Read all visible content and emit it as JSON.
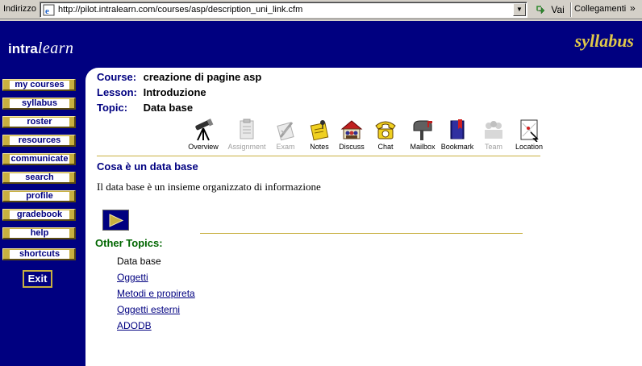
{
  "address_bar": {
    "label": "Indirizzo",
    "url": "http://pilot.intralearn.com/courses/asp/description_uni_link.cfm",
    "go_label": "Vai",
    "links_label": "Collegamenti",
    "links_chevron": "»"
  },
  "header": {
    "logo_bold": "intra",
    "logo_italic": "learn",
    "section_title": "syllabus"
  },
  "sidebar": {
    "items": [
      {
        "label": "my courses"
      },
      {
        "label": "syllabus"
      },
      {
        "label": "roster"
      },
      {
        "label": "resources"
      },
      {
        "label": "communicate"
      },
      {
        "label": "search"
      },
      {
        "label": "profile"
      },
      {
        "label": "gradebook"
      },
      {
        "label": "help"
      },
      {
        "label": "shortcuts"
      }
    ],
    "exit_label": "Exit"
  },
  "course_info": {
    "course_label": "Course:",
    "course_value": "creazione di pagine asp",
    "lesson_label": "Lesson:",
    "lesson_value": "Introduzione",
    "topic_label": "Topic:",
    "topic_value": "Data base"
  },
  "toolbar": {
    "tools": [
      {
        "label": "Overview",
        "icon": "telescope-icon",
        "enabled": true
      },
      {
        "label": "Assignment",
        "icon": "clipboard-icon",
        "enabled": false
      },
      {
        "label": "Exam",
        "icon": "exam-pencil-icon",
        "enabled": false
      },
      {
        "label": "Notes",
        "icon": "notes-icon",
        "enabled": true
      },
      {
        "label": "Discuss",
        "icon": "discuss-icon",
        "enabled": true
      },
      {
        "label": "Chat",
        "icon": "telephone-icon",
        "enabled": true
      },
      {
        "label": "Mailbox",
        "icon": "mailbox-icon",
        "enabled": true
      },
      {
        "label": "Bookmark",
        "icon": "bookmark-icon",
        "enabled": true
      },
      {
        "label": "Team",
        "icon": "team-icon",
        "enabled": false
      },
      {
        "label": "Location",
        "icon": "location-icon",
        "enabled": true
      }
    ]
  },
  "topic": {
    "title": "Cosa è un data base",
    "body": "Il data base è un insieme organizzato di informazione"
  },
  "other_topics": {
    "title": "Other Topics:",
    "items": [
      {
        "label": "Data base",
        "current": true
      },
      {
        "label": "Oggetti",
        "current": false
      },
      {
        "label": "Metodi e propireta",
        "current": false
      },
      {
        "label": "Oggetti esterni",
        "current": false
      },
      {
        "label": "ADODB",
        "current": false
      }
    ]
  },
  "colors": {
    "navy": "#000080",
    "gold": "#c8b040",
    "title_gold": "#e0c84a",
    "other_topics_green": "#006600"
  }
}
